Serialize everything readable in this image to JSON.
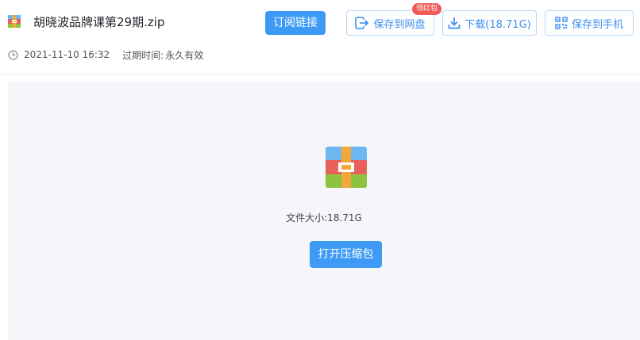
{
  "file": {
    "title": "胡晓波品牌课第29期.zip",
    "icon": "zip-archive-icon",
    "date": "2021-11-10 16:32",
    "expire_label": "过期时间:",
    "expire_value": "永久有效",
    "size_text": "文件大小:18.71G"
  },
  "toolbar": {
    "subscribe_label": "订阅链接",
    "save_label": "保存到网盘",
    "save_badge": "领红包",
    "download_label": "下载(18.71G)",
    "phone_label": "保存到手机"
  },
  "preview": {
    "open_label": "打开压缩包"
  },
  "colors": {
    "primary": "#3d9bf5",
    "badge": "#f25a5a",
    "preview_bg": "#f5f6fa"
  }
}
